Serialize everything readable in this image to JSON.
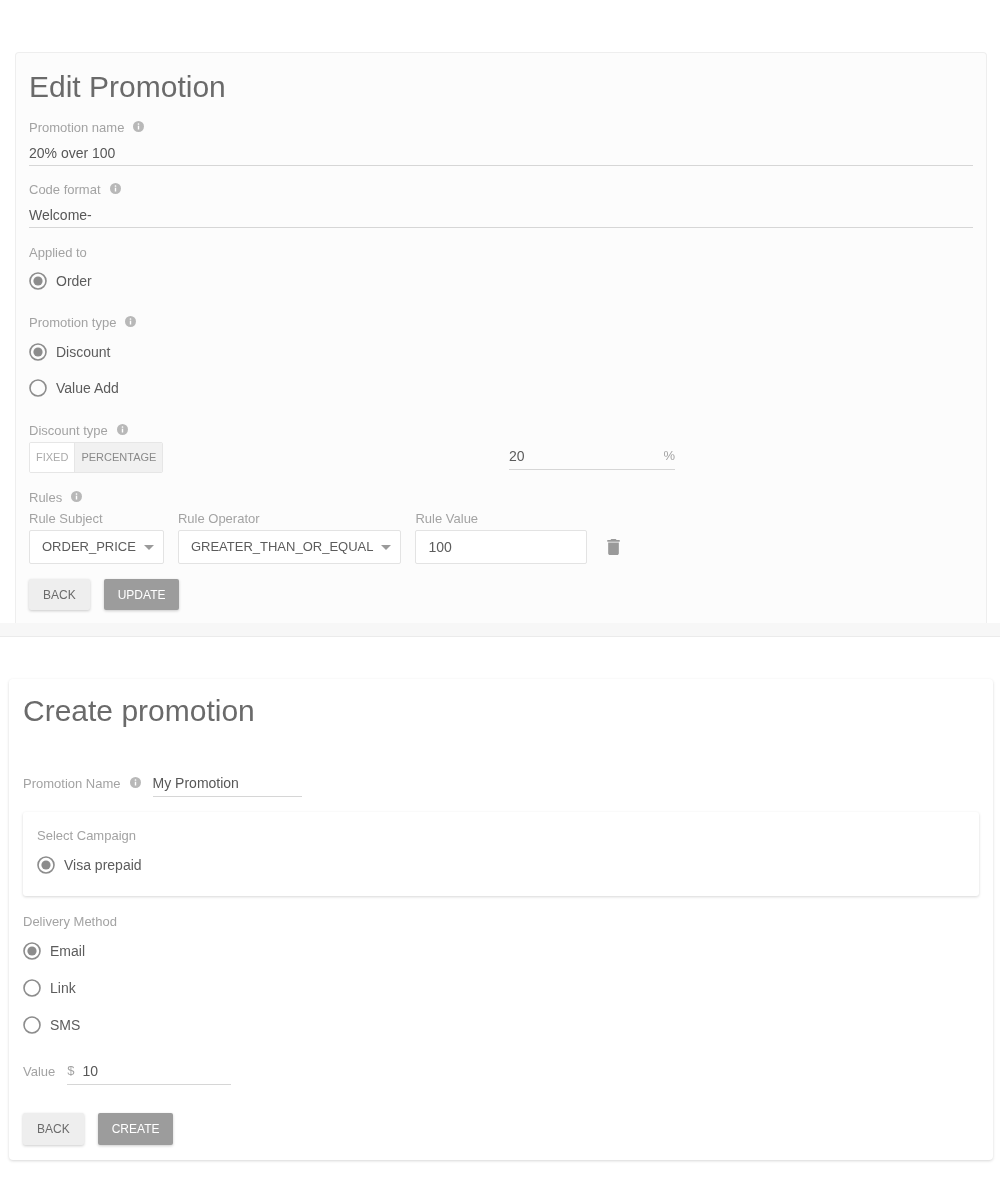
{
  "edit_promotion": {
    "title": "Edit Promotion",
    "fields": [
      {
        "label": "Promotion name",
        "info": true,
        "value": "20% over 100"
      },
      {
        "label": "Code format",
        "info": true,
        "value": "Welcome-"
      }
    ],
    "applied_to": {
      "label": "Applied to",
      "options": [
        {
          "label": "Order",
          "selected": true
        }
      ]
    },
    "promotion_type": {
      "label": "Promotion type",
      "info": true,
      "options": [
        {
          "label": "Discount",
          "selected": true
        },
        {
          "label": "Value Add",
          "selected": false
        }
      ]
    },
    "discount_type": {
      "label": "Discount type",
      "info": true,
      "options": [
        {
          "label": "FIXED",
          "selected": false
        },
        {
          "label": "PERCENTAGE",
          "selected": true
        }
      ],
      "amount": {
        "value": "20",
        "suffix": "%"
      }
    },
    "rules": {
      "label": "Rules",
      "info": true,
      "columns": [
        "Rule Subject",
        "Rule Operator",
        "Rule Value"
      ],
      "rows": [
        {
          "subject": "ORDER_PRICE",
          "operator": "GREATER_THAN_OR_EQUAL",
          "value": "100"
        }
      ]
    },
    "buttons": [
      {
        "label": "BACK",
        "kind": "secondary"
      },
      {
        "label": "UPDATE",
        "kind": "primary"
      }
    ]
  },
  "create_promotion": {
    "title": "Create promotion",
    "name_field": {
      "label": "Promotion Name",
      "info": true,
      "value": "My Promotion"
    },
    "campaign": {
      "label": "Select Campaign",
      "options": [
        {
          "label": "Visa prepaid",
          "selected": true
        }
      ]
    },
    "delivery_method": {
      "label": "Delivery Method",
      "options": [
        {
          "label": "Email",
          "selected": true
        },
        {
          "label": "Link",
          "selected": false
        },
        {
          "label": "SMS",
          "selected": false
        }
      ]
    },
    "value_field": {
      "label": "Value",
      "prefix": "$",
      "value": "10"
    },
    "buttons": [
      {
        "label": "BACK",
        "kind": "secondary"
      },
      {
        "label": "CREATE",
        "kind": "primary"
      }
    ]
  }
}
